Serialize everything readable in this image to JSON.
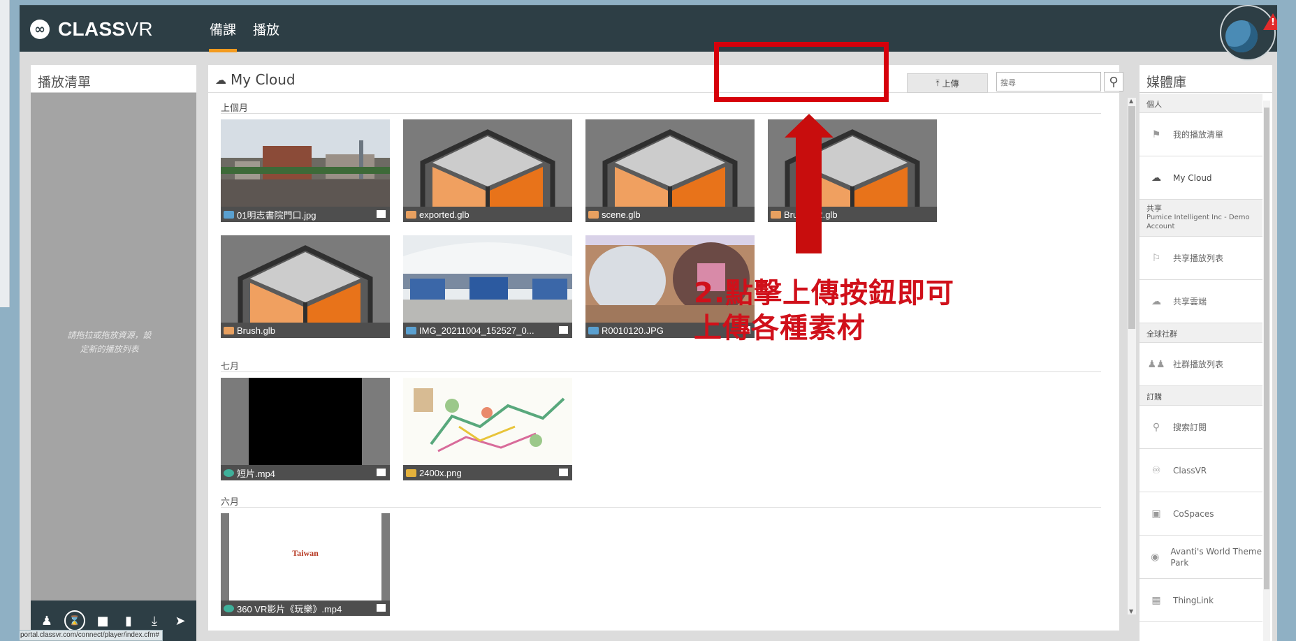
{
  "app": {
    "logo_text": "CLASS",
    "logo_text2": "VR"
  },
  "nav": [
    "備課",
    "播放"
  ],
  "left_panel": {
    "title": "播放清單",
    "hint": "請拖拉或拖放資源，設定新的播放列表"
  },
  "status_url": "portal.classvr.com/connect/player/index.cfm#",
  "main": {
    "title": "My Cloud",
    "upload_label": "上傳",
    "search_placeholder": "搜尋",
    "sections": [
      "上個月",
      "七月",
      "六月"
    ],
    "items": [
      {
        "name": "01明志書院門口.jpg",
        "type": "image"
      },
      {
        "name": "exported.glb",
        "type": "3d"
      },
      {
        "name": "scene.glb",
        "type": "3d"
      },
      {
        "name": "Brush002.glb",
        "type": "3d"
      },
      {
        "name": "Brush.glb",
        "type": "3d"
      },
      {
        "name": "IMG_20211004_152527_0...",
        "type": "image"
      },
      {
        "name": "R0010120.JPG",
        "type": "image"
      },
      {
        "name": "短片.mp4",
        "type": "video"
      },
      {
        "name": "2400x.png",
        "type": "image"
      },
      {
        "name": "360 VR影片《玩樂》.mp4",
        "type": "video"
      }
    ],
    "thumb_text": "Taiwan"
  },
  "library": {
    "title": "媒體庫",
    "sections": {
      "personal": "個人",
      "shared": "共享",
      "shared_sub": "Pumice Intelligent Inc - Demo Account",
      "community": "全球社群",
      "subscribe": "訂購"
    },
    "items": [
      "我的播放清單",
      "My Cloud",
      "共享播放列表",
      "共享雲端",
      "社群播放列表",
      "搜索訂閱",
      "ClassVR",
      "CoSpaces",
      "Avanti's World Theme Park",
      "ThingLink"
    ]
  },
  "annotation": {
    "line1": "2.點擊上傳按鈕即可",
    "line2": "上傳各種素材"
  },
  "colors": {
    "topbar": "#2d3e45",
    "accent": "#f39b1f",
    "annotation": "#d0101a",
    "thumb_orange": "#e8731a"
  }
}
